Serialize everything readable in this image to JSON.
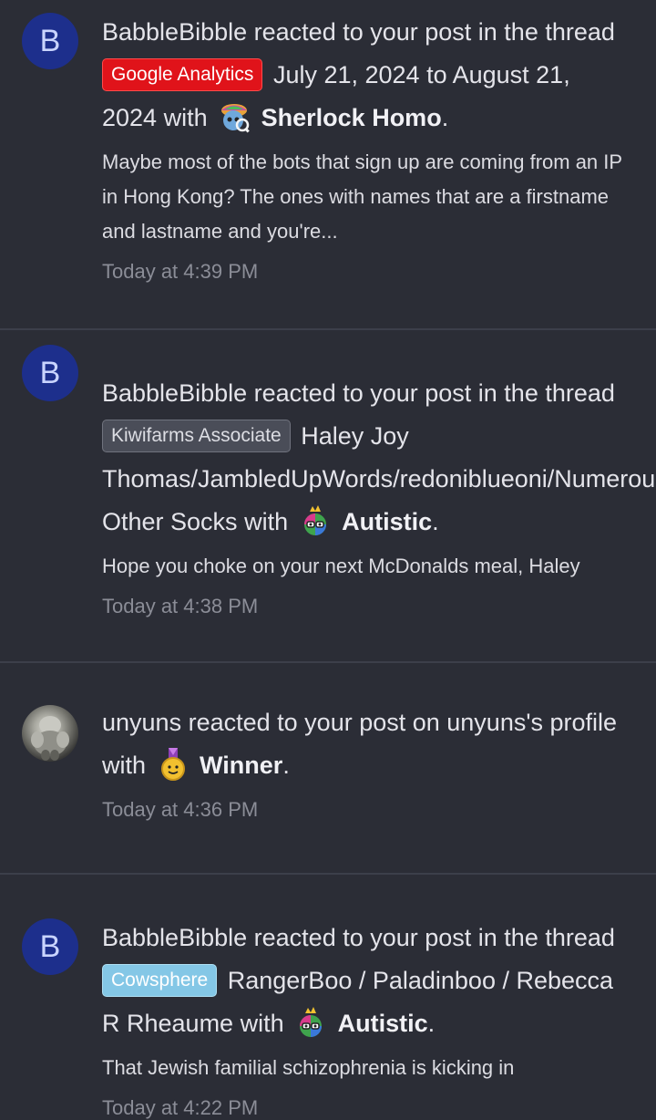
{
  "alerts": [
    {
      "avatar_letter": "B",
      "user": "BabbleBibble",
      "action_text": "reacted to your post in the thread",
      "prefix": {
        "label": "Google Analytics",
        "color": "#e0131a"
      },
      "thread_title": "July 21, 2024 to August 21, 2024",
      "with_text": "with",
      "reaction": {
        "name": "Sherlock Homo",
        "icon": "sherlock-reaction-icon"
      },
      "period": ".",
      "snippet": "Maybe most of the bots that sign up are coming from an IP in Hong Kong? The ones with names that are a firstname and lastname and you're...",
      "time": "Today at 4:39 PM"
    },
    {
      "avatar_letter": "B",
      "user": "BabbleBibble",
      "action_text": "reacted to your post in the thread",
      "prefix": {
        "label": "Kiwifarms Associate",
        "color": "#4a4d58"
      },
      "thread_title": "Haley Joy Thomas/JambledUpWords/redoniblueoni/Numerous Other Socks",
      "with_text": "with",
      "reaction": {
        "name": "Autistic",
        "icon": "autistic-reaction-icon"
      },
      "period": ".",
      "snippet": "Hope you choke on your next McDonalds meal, Haley",
      "time": "Today at 4:38 PM"
    },
    {
      "avatar_letter": "",
      "user": "unyuns",
      "action_text": "reacted to your post on unyuns's profile",
      "with_text": "with",
      "reaction": {
        "name": "Winner",
        "icon": "winner-medal-icon"
      },
      "period": ".",
      "time": "Today at 4:36 PM"
    },
    {
      "avatar_letter": "B",
      "user": "BabbleBibble",
      "action_text": "reacted to your post in the thread",
      "prefix": {
        "label": "Cowsphere",
        "color": "#84c7e6"
      },
      "thread_title": "RangerBoo / Paladinboo / Rebecca R Rheaume",
      "with_text": "with",
      "reaction": {
        "name": "Autistic",
        "icon": "autistic-reaction-icon"
      },
      "period": ".",
      "snippet": "That Jewish familial schizophrenia is kicking in",
      "time": "Today at 4:22 PM"
    }
  ]
}
